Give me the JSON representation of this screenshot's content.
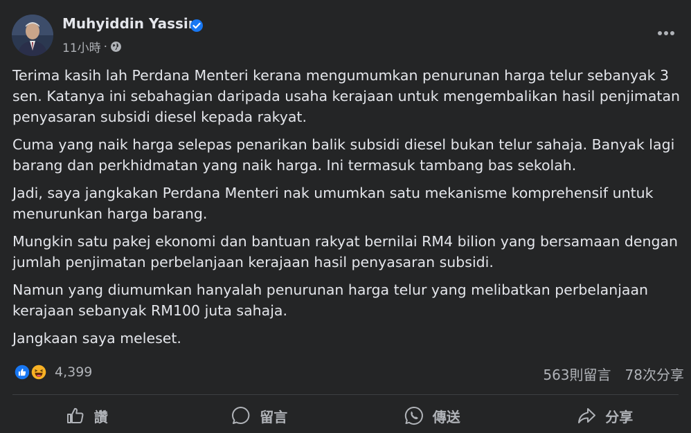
{
  "post": {
    "author": "Muhyiddin Yassin",
    "time": "11小時",
    "separator": "·",
    "more_icon": "more-horizontal-icon",
    "privacy_icon": "globe-icon",
    "verified_icon": "verified-badge-icon",
    "paragraphs": [
      "Terima kasih lah Perdana Menteri kerana mengumumkan penurunan harga telur sebanyak 3 sen. Katanya ini sebahagian daripada usaha kerajaan untuk mengembalikan hasil penjimatan penyasaran subsidi diesel kepada rakyat.",
      "Cuma yang naik harga selepas penarikan balik subsidi diesel bukan telur sahaja. Banyak lagi barang dan perkhidmatan yang naik harga. Ini termasuk tambang bas sekolah.",
      "Jadi, saya jangkakan Perdana Menteri nak umumkan satu mekanisme komprehensif untuk menurunkan harga barang.",
      "Mungkin satu pakej ekonomi dan bantuan rakyat bernilai RM4 bilion yang bersamaan dengan jumlah penjimatan perbelanjaan kerajaan hasil penyasaran subsidi.",
      "Namun yang diumumkan hanyalah penurunan harga telur yang melibatkan perbelanjaan kerajaan sebanyak RM100 juta sahaja.",
      "Jangkaan saya meleset."
    ]
  },
  "stats": {
    "reaction_count": "4,399",
    "comments": "563則留言",
    "shares": "78次分享"
  },
  "actions": {
    "like": "讚",
    "comment": "留言",
    "send": "傳送",
    "share": "分享"
  },
  "colors": {
    "background": "#242526",
    "text_primary": "#e4e6eb",
    "text_secondary": "#b0b3b8",
    "like_blue": "#1877f2",
    "verified_blue": "#1877f2",
    "haha_yellow": "#f7b125"
  }
}
